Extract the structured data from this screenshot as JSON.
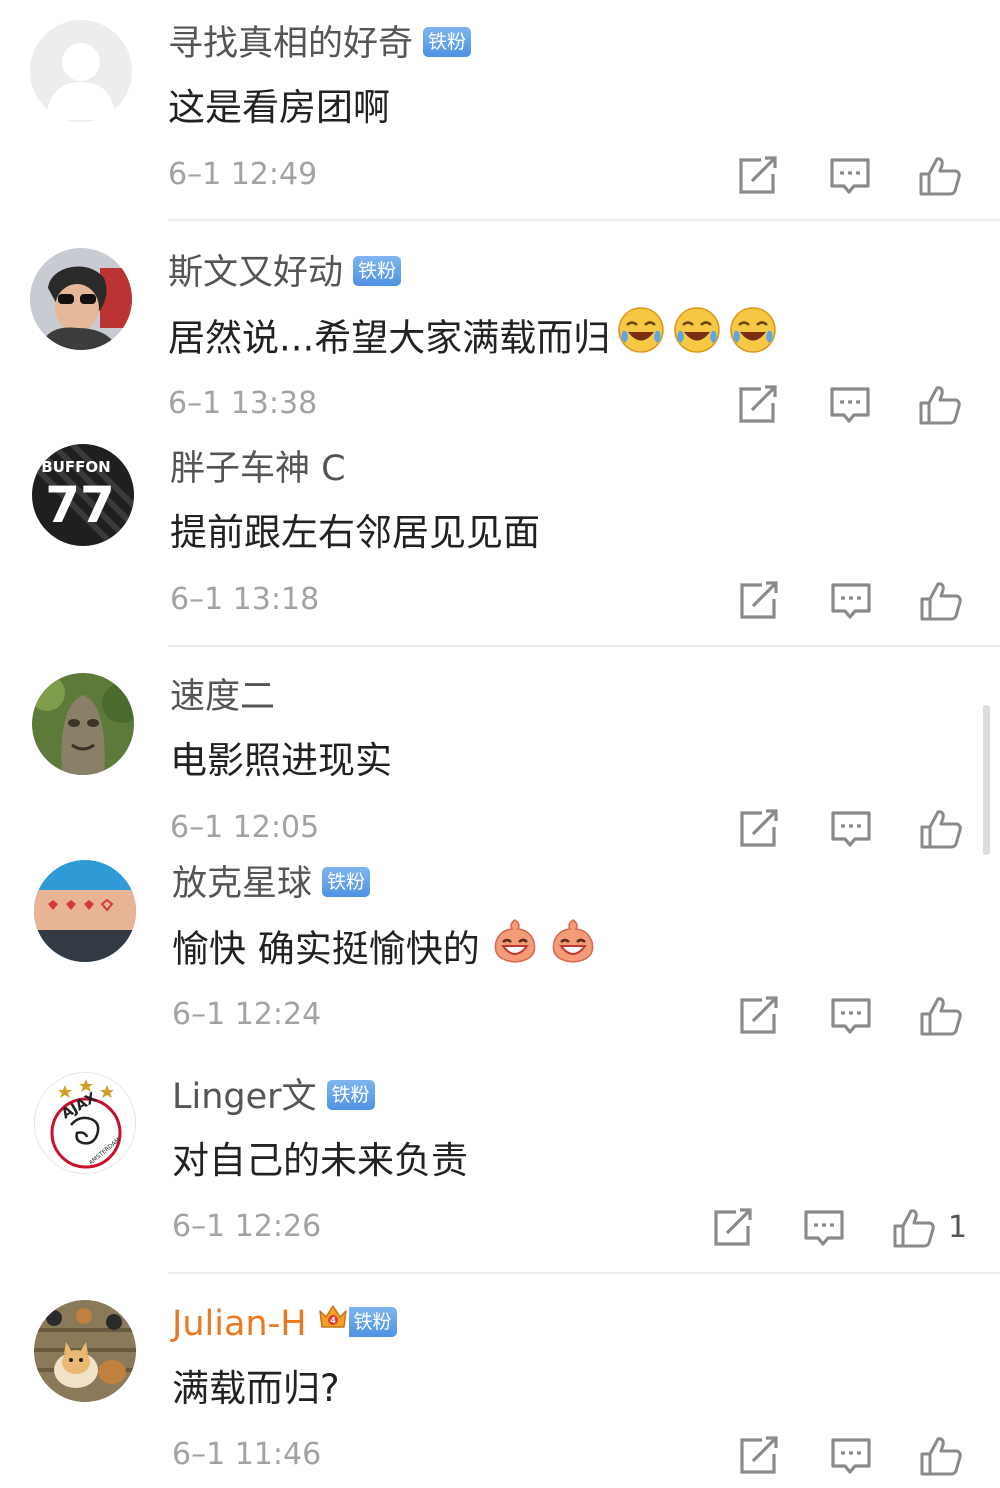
{
  "comments": [
    {
      "user": "寻找真相的好奇",
      "badge": "铁粉",
      "text": "这是看房团啊",
      "time": "6–1 12:49",
      "avatar_icon": "default-avatar-icon"
    },
    {
      "user": "斯文又好动",
      "badge": "铁粉",
      "text": "居然说...希望大家满载而归",
      "time": "6–1 13:38",
      "emoji_icon": "laugh-cry-emoji-icon",
      "emoji_count": 3,
      "avatar_icon": "woman-sunglasses-avatar"
    },
    {
      "user": "胖子车神 C",
      "text": "提前跟左右邻居见见面",
      "time": "6–1 13:18",
      "avatar_jersey": "77",
      "avatar_name": "BUFFON"
    },
    {
      "user": "速度二",
      "text": "电影照进现实",
      "time": "6–1 12:05",
      "avatar_icon": "tree-face-avatar"
    },
    {
      "user": "放克星球",
      "badge": "铁粉",
      "text": "愉快 确实挺愉快的",
      "time": "6–1 12:24",
      "emoji_icon": "grin-face-emoji-icon",
      "emoji_count": 2,
      "avatar_icon": "hearts-arm-avatar"
    },
    {
      "user": "Linger文",
      "badge": "铁粉",
      "text": "对自己的未来负责",
      "time": "6–1 12:26",
      "like_count": "1",
      "avatar_logo": "AJAX",
      "avatar_logo_sub": "AMSTERDAM"
    },
    {
      "user": "Julian-H",
      "badge": "铁粉",
      "vip_level": "4",
      "text": "满载而归?",
      "time": "6–1 11:46",
      "avatar_icon": "dogs-avatar"
    }
  ],
  "colors": {
    "username": "#555555",
    "vip_username": "#ea7a22",
    "badge_bg": "#5b9ee8",
    "text": "#222222",
    "time": "#a3a3a3",
    "icon": "#8a8a8a"
  },
  "icons": {
    "repost": "share-icon",
    "comment": "comment-icon",
    "like": "like-icon"
  }
}
